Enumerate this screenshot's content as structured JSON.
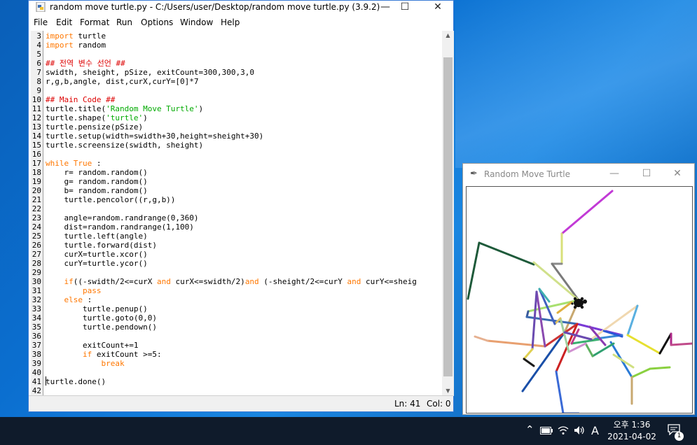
{
  "idle_window": {
    "title": "random move turtle.py - C:/Users/user/Desktop/random move turtle.py (3.9.2)",
    "controls": {
      "minimize": "—",
      "maximize": "☐",
      "close": "✕"
    },
    "menu": [
      "File",
      "Edit",
      "Format",
      "Run",
      "Options",
      "Window",
      "Help"
    ],
    "line_numbers": [
      "3",
      "4",
      "5",
      "6",
      "7",
      "8",
      "9",
      "10",
      "11",
      "12",
      "13",
      "14",
      "15",
      "16",
      "17",
      "18",
      "19",
      "20",
      "21",
      "22",
      "23",
      "24",
      "25",
      "26",
      "27",
      "28",
      "29",
      "30",
      "31",
      "32",
      "33",
      "34",
      "35",
      "36",
      "37",
      "38",
      "39",
      "40",
      "41",
      "42"
    ],
    "status": {
      "line": "Ln: 41",
      "col": "Col: 0"
    }
  },
  "code_lines": [
    [
      {
        "t": "import",
        "k": "kw"
      },
      {
        "t": " turtle"
      }
    ],
    [
      {
        "t": "import",
        "k": "kw"
      },
      {
        "t": " random"
      }
    ],
    [],
    [
      {
        "t": "## 전역 변수 선언 ##",
        "k": "cmt"
      }
    ],
    [
      {
        "t": "swidth, sheight, pSize, exitCount=300,300,3,0"
      }
    ],
    [
      {
        "t": "r,g,b,angle, dist,curX,curY=[0]*7"
      }
    ],
    [],
    [
      {
        "t": "## Main Code ##",
        "k": "cmt"
      }
    ],
    [
      {
        "t": "turtle.title("
      },
      {
        "t": "'Random Move Turtle'",
        "k": "str"
      },
      {
        "t": ")"
      }
    ],
    [
      {
        "t": "turtle.shape("
      },
      {
        "t": "'turtle'",
        "k": "str"
      },
      {
        "t": ")"
      }
    ],
    [
      {
        "t": "turtle.pensize(pSize)"
      }
    ],
    [
      {
        "t": "turtle.setup(width=swidth+30,height=sheight+30)"
      }
    ],
    [
      {
        "t": "turtle.screensize(swidth, sheight)"
      }
    ],
    [],
    [
      {
        "t": "while",
        "k": "kw"
      },
      {
        "t": " "
      },
      {
        "t": "True",
        "k": "kw"
      },
      {
        "t": " :"
      }
    ],
    [
      {
        "t": "    r= random.random()"
      }
    ],
    [
      {
        "t": "    g= random.random()"
      }
    ],
    [
      {
        "t": "    b= random.random()"
      }
    ],
    [
      {
        "t": "    turtle.pencolor((r,g,b))"
      }
    ],
    [],
    [
      {
        "t": "    angle=random.randrange(0,360)"
      }
    ],
    [
      {
        "t": "    dist=random.randrange(1,100)"
      }
    ],
    [
      {
        "t": "    turtle.left(angle)"
      }
    ],
    [
      {
        "t": "    turtle.forward(dist)"
      }
    ],
    [
      {
        "t": "    curX=turtle.xcor()"
      }
    ],
    [
      {
        "t": "    curY=turtle.ycor()"
      }
    ],
    [],
    [
      {
        "t": "    "
      },
      {
        "t": "if",
        "k": "kw"
      },
      {
        "t": "((-swidth/2<=curX "
      },
      {
        "t": "and",
        "k": "kw"
      },
      {
        "t": " curX<=swidth/2)"
      },
      {
        "t": "and",
        "k": "kw"
      },
      {
        "t": " (-sheight/2<=curY "
      },
      {
        "t": "and",
        "k": "kw"
      },
      {
        "t": " curY<=sheig"
      }
    ],
    [
      {
        "t": "        "
      },
      {
        "t": "pass",
        "k": "kw"
      }
    ],
    [
      {
        "t": "    "
      },
      {
        "t": "else",
        "k": "kw"
      },
      {
        "t": " :"
      }
    ],
    [
      {
        "t": "        turtle.penup()"
      }
    ],
    [
      {
        "t": "        turtle.goto(0,0)"
      }
    ],
    [
      {
        "t": "        turtle.pendown()"
      }
    ],
    [],
    [
      {
        "t": "        exitCount+=1"
      }
    ],
    [
      {
        "t": "        "
      },
      {
        "t": "if",
        "k": "kw"
      },
      {
        "t": " exitCount >=5:"
      }
    ],
    [
      {
        "t": "            "
      },
      {
        "t": "break",
        "k": "kw"
      }
    ],
    [],
    [
      {
        "t": "turtle.done()"
      }
    ],
    []
  ],
  "turtle_window": {
    "title": "Random Move Turtle",
    "controls": {
      "minimize": "—",
      "maximize": "☐",
      "close": "✕"
    }
  },
  "turtle_segments": [
    [
      208,
      6,
      136,
      67,
      "#c23ad6"
    ],
    [
      136,
      67,
      136,
      110,
      "#d8e07a"
    ],
    [
      136,
      110,
      122,
      110,
      "#8a8a8a"
    ],
    [
      122,
      110,
      160,
      162,
      "#7a7a7a"
    ],
    [
      96,
      111,
      18,
      80,
      "#1e5a3a"
    ],
    [
      18,
      80,
      2,
      160,
      "#1e5a3a"
    ],
    [
      160,
      162,
      96,
      108,
      "#d0e08a"
    ],
    [
      160,
      162,
      140,
      208,
      "#c8a870"
    ],
    [
      140,
      208,
      80,
      292,
      "#1a4fa8"
    ],
    [
      160,
      162,
      88,
      178,
      "#a8e070"
    ],
    [
      88,
      178,
      86,
      186,
      "#3a5a9a"
    ],
    [
      86,
      186,
      158,
      196,
      "#3a6ab0"
    ],
    [
      158,
      196,
      112,
      228,
      "#cc3333"
    ],
    [
      112,
      228,
      30,
      220,
      "#e8a070"
    ],
    [
      30,
      220,
      12,
      214,
      "#e6b090"
    ],
    [
      112,
      228,
      100,
      150,
      "#8a4ab0"
    ],
    [
      100,
      150,
      94,
      232,
      "#6a4ab0"
    ],
    [
      94,
      232,
      82,
      246,
      "#e0d050"
    ],
    [
      158,
      196,
      222,
      212,
      "#7a3ad6"
    ],
    [
      222,
      212,
      178,
      218,
      "#3a8ad6"
    ],
    [
      178,
      218,
      244,
      170,
      "#f0d8b0"
    ],
    [
      244,
      170,
      230,
      212,
      "#5ab0e0"
    ],
    [
      230,
      212,
      276,
      238,
      "#e6e030"
    ],
    [
      276,
      238,
      292,
      210,
      "#111111"
    ],
    [
      292,
      210,
      292,
      226,
      "#b02a8a"
    ],
    [
      292,
      226,
      322,
      224,
      "#c04a8a"
    ],
    [
      158,
      196,
      128,
      264,
      "#cc2222"
    ],
    [
      128,
      264,
      138,
      324,
      "#3a6ad6"
    ],
    [
      138,
      324,
      160,
      324,
      "#3a6ad6"
    ],
    [
      206,
      222,
      236,
      272,
      "#2a7ad6"
    ],
    [
      236,
      272,
      262,
      260,
      "#8ad040"
    ],
    [
      262,
      260,
      290,
      258,
      "#8ad040"
    ],
    [
      236,
      272,
      236,
      310,
      "#c8a870"
    ],
    [
      210,
      224,
      180,
      242,
      "#30a070"
    ],
    [
      180,
      242,
      170,
      224,
      "#60b060"
    ],
    [
      170,
      224,
      146,
      236,
      "#d090d0"
    ],
    [
      146,
      236,
      134,
      188,
      "#a0d0a0"
    ],
    [
      134,
      188,
      126,
      196,
      "#e0c060"
    ],
    [
      126,
      196,
      104,
      146,
      "#4060c0"
    ],
    [
      190,
      218,
      150,
      224,
      "#3ab070"
    ],
    [
      150,
      224,
      160,
      204,
      "#c03a8a"
    ],
    [
      104,
      146,
      118,
      164,
      "#40b0b0"
    ],
    [
      140,
      208,
      178,
      218,
      "#6a4ab0"
    ],
    [
      82,
      246,
      96,
      256,
      "#1a1a1a"
    ],
    [
      130,
      180,
      150,
      165,
      "#e0b040"
    ],
    [
      196,
      206,
      222,
      214,
      "#2a5ad6"
    ],
    [
      210,
      240,
      238,
      258,
      "#d0e080"
    ],
    [
      176,
      200,
      198,
      226,
      "#8a3ab0"
    ]
  ],
  "taskbar": {
    "tray_icons": [
      "^",
      "battery",
      "wifi",
      "volume",
      "A"
    ],
    "ime": "A",
    "time": "오후 1:36",
    "date": "2021-04-02",
    "notification_count": "1"
  }
}
